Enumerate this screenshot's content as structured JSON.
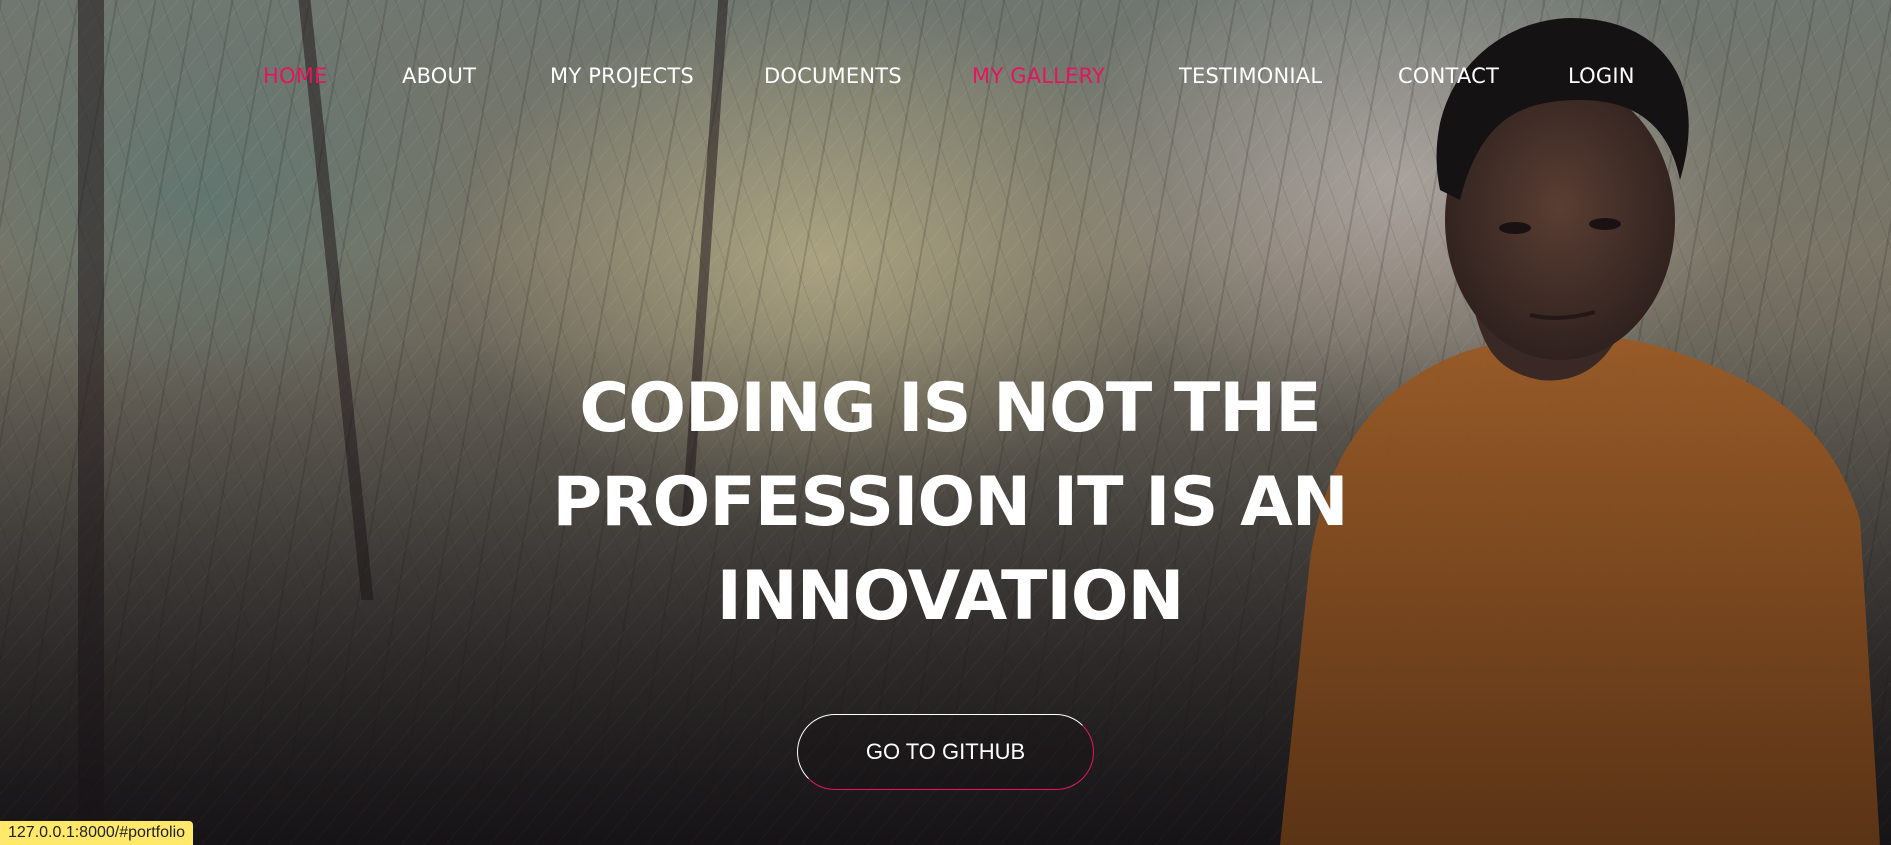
{
  "nav": {
    "items": [
      {
        "label": "HOME",
        "active": true
      },
      {
        "label": "ABOUT",
        "active": false
      },
      {
        "label": "MY PROJECTS",
        "active": false
      },
      {
        "label": "DOCUMENTS",
        "active": false
      },
      {
        "label": "MY GALLERY",
        "active": true
      },
      {
        "label": "TESTIMONIAL",
        "active": false
      },
      {
        "label": "CONTACT",
        "active": false
      },
      {
        "label": "LOGIN",
        "active": false
      }
    ]
  },
  "hero": {
    "headline_line1": "CODING IS NOT THE",
    "headline_line2": "PROFESSION IT IS AN",
    "headline_line3": "INNOVATION",
    "cta_label": "GO TO GITHUB"
  },
  "status_bar": {
    "url": "127.0.0.1:8000/#portfolio"
  },
  "colors": {
    "accent": "#e6145f",
    "text": "#ffffff",
    "status_bg": "#ffe86a"
  }
}
